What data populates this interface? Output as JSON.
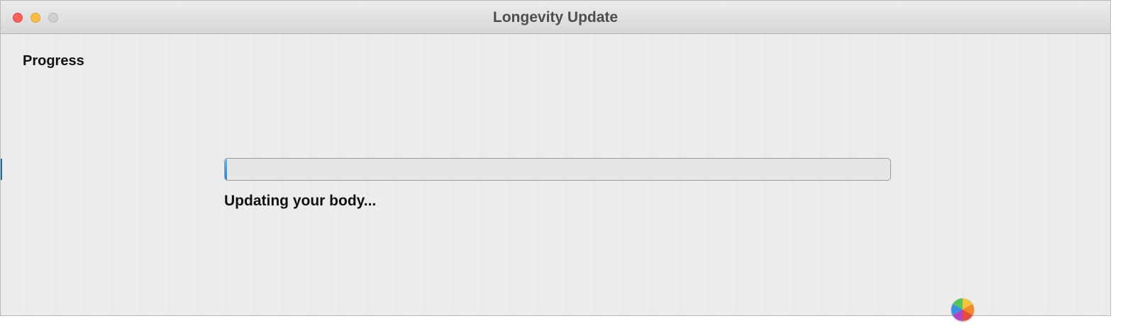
{
  "window": {
    "title": "Longevity Update"
  },
  "content": {
    "heading": "Progress",
    "progress_fraction": 0.003,
    "status_text": "Updating your body..."
  },
  "colors": {
    "close": "#fc605c",
    "minimize": "#fdbc40",
    "zoom": "#d1d0d1",
    "progress_accent": "#1f82d3"
  },
  "icons": {
    "busy_cursor": "spinning-wait-cursor-icon"
  }
}
